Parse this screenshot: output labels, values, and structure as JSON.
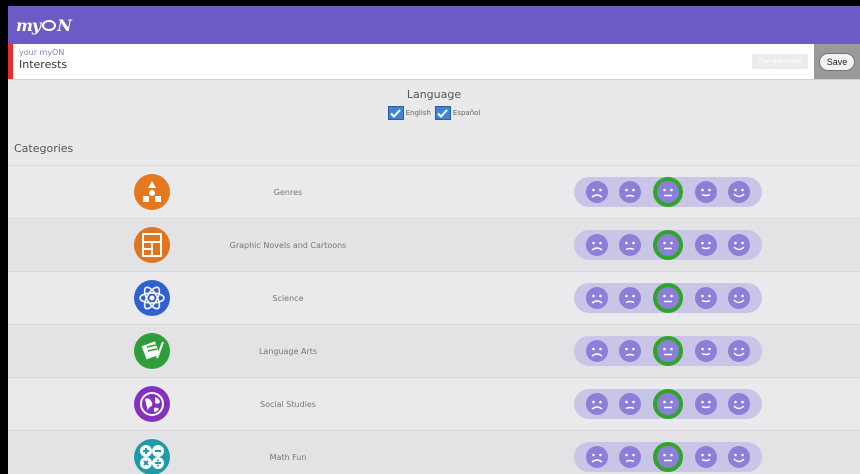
{
  "app": {
    "logo_prefix": "my",
    "logo_suffix": "N"
  },
  "header": {
    "small_label": "your myON",
    "title": "Interests",
    "changes_label": "changes made",
    "save_label": "Save"
  },
  "language": {
    "title": "Language",
    "options": [
      {
        "label": "English",
        "checked": true
      },
      {
        "label": "Español",
        "checked": true
      }
    ]
  },
  "categories_label": "Categories",
  "categories": [
    {
      "name": "Genres",
      "icon": "genres-icon",
      "color": "#e4781f",
      "rating": 3
    },
    {
      "name": "Graphic Novels and Cartoons",
      "icon": "comic-book-icon",
      "color": "#e2731f",
      "rating": 3
    },
    {
      "name": "Science",
      "icon": "atom-icon",
      "color": "#2f5fd0",
      "rating": 3
    },
    {
      "name": "Language Arts",
      "icon": "scroll-quill-icon",
      "color": "#2f9d3a",
      "rating": 3
    },
    {
      "name": "Social Studies",
      "icon": "globe-icon",
      "color": "#8431c0",
      "rating": 3
    },
    {
      "name": "Math Fun",
      "icon": "math-operators-icon",
      "color": "#1f9aa8",
      "rating": 3
    }
  ],
  "rating_scale": [
    "very-sad",
    "sad",
    "neutral",
    "happy",
    "very-happy"
  ],
  "colors": {
    "topbar": "#6a5cc4",
    "accent": "#e52e2e",
    "rating_track": "#c9c5e6",
    "face": "#8c7fd8",
    "selected_ring": "#2fa52a"
  }
}
